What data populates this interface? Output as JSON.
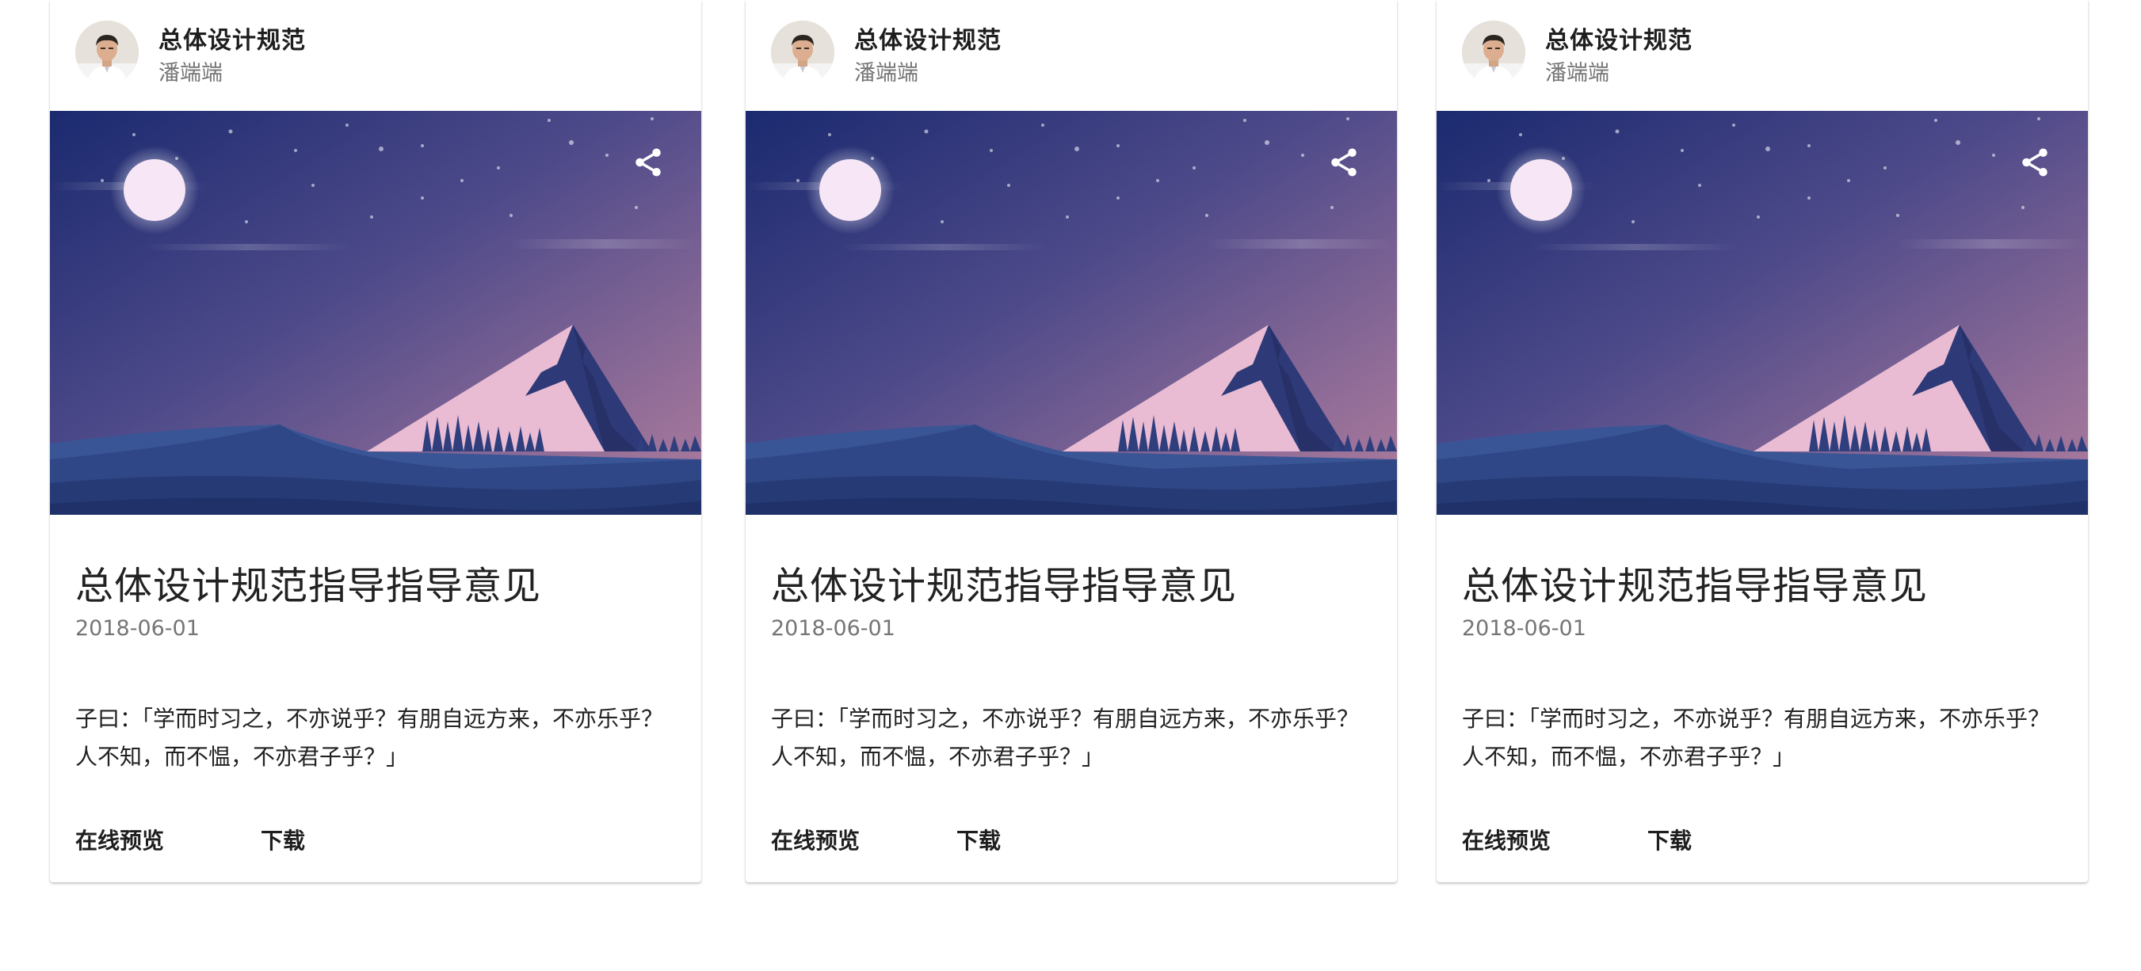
{
  "cards": [
    {
      "title": "总体设计规范",
      "subtitle": "潘端端",
      "heading": "总体设计规范指导指导意见",
      "date": "2018-06-01",
      "body_line1": "子曰：「学而时习之，不亦说乎？有朋自远方来，不亦乐乎？",
      "body_line2": "人不知，而不愠，不亦君子乎？」",
      "preview_label": "在线预览",
      "download_label": "下载",
      "share_icon": "share-icon",
      "media_image": "night-mountain-landscape"
    },
    {
      "title": "总体设计规范",
      "subtitle": "潘端端",
      "heading": "总体设计规范指导指导意见",
      "date": "2018-06-01",
      "body_line1": "子曰：「学而时习之，不亦说乎？有朋自远方来，不亦乐乎？",
      "body_line2": "人不知，而不愠，不亦君子乎？」",
      "preview_label": "在线预览",
      "download_label": "下载",
      "share_icon": "share-icon",
      "media_image": "night-mountain-landscape"
    },
    {
      "title": "总体设计规范",
      "subtitle": "潘端端",
      "heading": "总体设计规范指导指导意见",
      "date": "2018-06-01",
      "body_line1": "子曰：「学而时习之，不亦说乎？有朋自远方来，不亦乐乎？",
      "body_line2": "人不知，而不愠，不亦君子乎？」",
      "preview_label": "在线预览",
      "download_label": "下载",
      "share_icon": "share-icon",
      "media_image": "night-mountain-landscape"
    }
  ],
  "colors": {
    "sky_top": "#1d2a6e",
    "sky_bottom": "#a7789c",
    "moon": "#f6e6f6",
    "mountain_light": "#f0c9dc",
    "mountain_dark": "#2c3672",
    "hills": "#34508f"
  }
}
